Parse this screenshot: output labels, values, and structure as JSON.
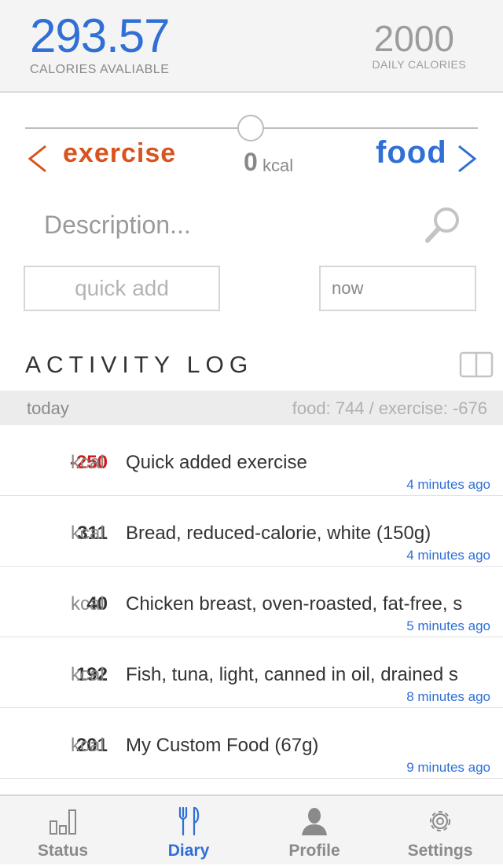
{
  "header": {
    "calories_available": "293.57",
    "calories_available_label": "CALORIES AVALIABLE",
    "daily_calories": "2000",
    "daily_calories_label": "DAILY CALORIES"
  },
  "toggle": {
    "exercise_label": "exercise",
    "kcal_value": "0",
    "kcal_unit": "kcal",
    "food_label": "food"
  },
  "entry": {
    "description_placeholder": "Description...",
    "quick_add_placeholder": "quick add",
    "time_value": "now"
  },
  "log": {
    "title": "ACTIVITY LOG",
    "day_label": "today",
    "day_summary": "food: 744 / exercise: -676",
    "rows": [
      {
        "kcal": "-250",
        "unit": "kcal",
        "name": "Quick added exercise",
        "time": "4 minutes ago"
      },
      {
        "kcal": "311",
        "unit": "kcal",
        "name": "Bread, reduced-calorie, white (150g)",
        "time": "4 minutes ago"
      },
      {
        "kcal": "40",
        "unit": "kcal",
        "name": "Chicken breast, oven-roasted, fat-free, s",
        "time": "5 minutes ago"
      },
      {
        "kcal": "192",
        "unit": "kcal",
        "name": "Fish, tuna, light, canned in oil, drained s",
        "time": "8 minutes ago"
      },
      {
        "kcal": "201",
        "unit": "kcal",
        "name": "My Custom Food (67g)",
        "time": "9 minutes ago"
      }
    ]
  },
  "tabs": [
    {
      "label": "Status",
      "icon": "bar-chart-icon"
    },
    {
      "label": "Diary",
      "icon": "fork-knife-icon"
    },
    {
      "label": "Profile",
      "icon": "person-icon"
    },
    {
      "label": "Settings",
      "icon": "gear-icon"
    }
  ],
  "colors": {
    "accent_blue": "#2f6fd6",
    "exercise_orange": "#d9531e",
    "negative_red": "#d01a1a"
  }
}
